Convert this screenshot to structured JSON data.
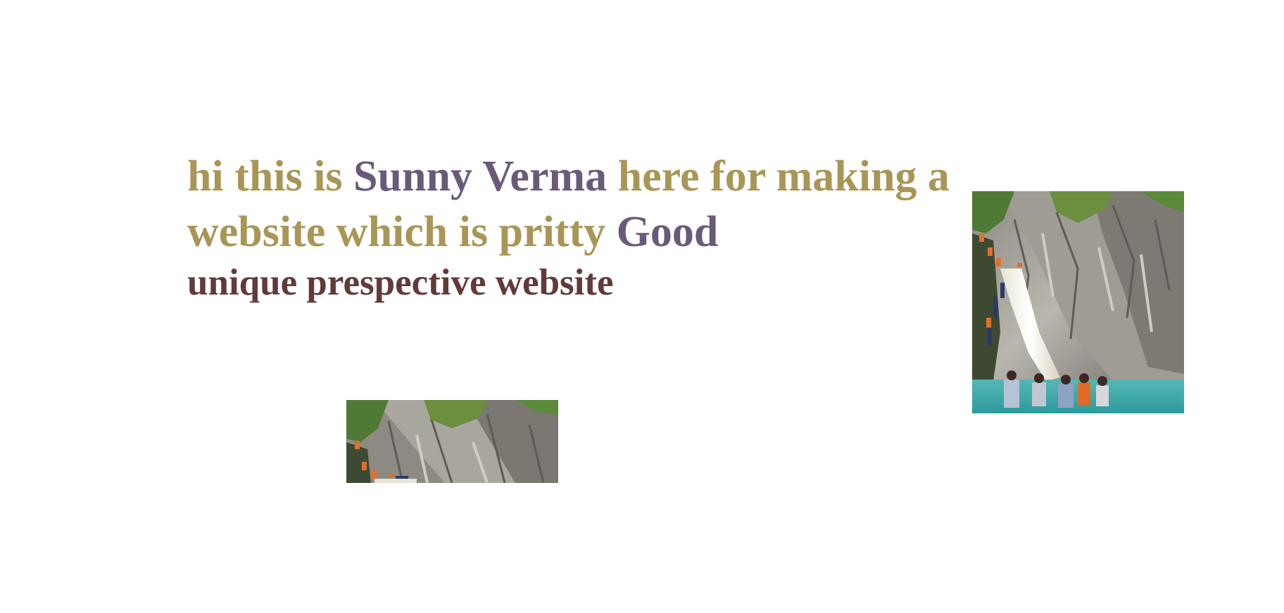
{
  "hero": {
    "line_prefix": "hi this is ",
    "name": "Sunny Verma",
    "line_middle": " here for making a website which is pritty ",
    "good": "Good",
    "tagline": "unique prespective website"
  },
  "images": {
    "large": "waterfall-photo",
    "small": "waterfall-photo-cropped"
  },
  "colors": {
    "headline": "#a99656",
    "name": "#6a5a7a",
    "tagline": "#623a3a"
  }
}
